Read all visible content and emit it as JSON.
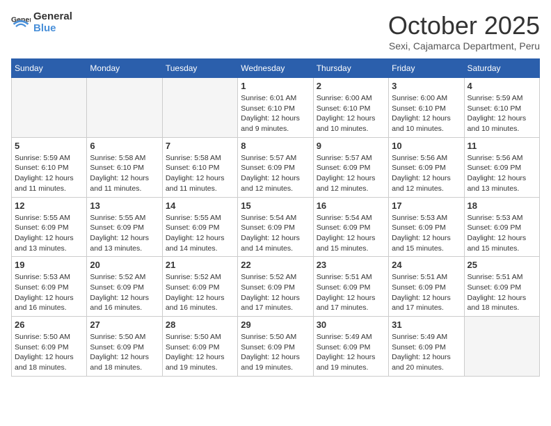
{
  "logo": {
    "text_general": "General",
    "text_blue": "Blue"
  },
  "header": {
    "month": "October 2025",
    "location": "Sexi, Cajamarca Department, Peru"
  },
  "weekdays": [
    "Sunday",
    "Monday",
    "Tuesday",
    "Wednesday",
    "Thursday",
    "Friday",
    "Saturday"
  ],
  "weeks": [
    [
      {
        "day": "",
        "info": ""
      },
      {
        "day": "",
        "info": ""
      },
      {
        "day": "",
        "info": ""
      },
      {
        "day": "1",
        "info": "Sunrise: 6:01 AM\nSunset: 6:10 PM\nDaylight: 12 hours and 9 minutes."
      },
      {
        "day": "2",
        "info": "Sunrise: 6:00 AM\nSunset: 6:10 PM\nDaylight: 12 hours and 10 minutes."
      },
      {
        "day": "3",
        "info": "Sunrise: 6:00 AM\nSunset: 6:10 PM\nDaylight: 12 hours and 10 minutes."
      },
      {
        "day": "4",
        "info": "Sunrise: 5:59 AM\nSunset: 6:10 PM\nDaylight: 12 hours and 10 minutes."
      }
    ],
    [
      {
        "day": "5",
        "info": "Sunrise: 5:59 AM\nSunset: 6:10 PM\nDaylight: 12 hours and 11 minutes."
      },
      {
        "day": "6",
        "info": "Sunrise: 5:58 AM\nSunset: 6:10 PM\nDaylight: 12 hours and 11 minutes."
      },
      {
        "day": "7",
        "info": "Sunrise: 5:58 AM\nSunset: 6:10 PM\nDaylight: 12 hours and 11 minutes."
      },
      {
        "day": "8",
        "info": "Sunrise: 5:57 AM\nSunset: 6:09 PM\nDaylight: 12 hours and 12 minutes."
      },
      {
        "day": "9",
        "info": "Sunrise: 5:57 AM\nSunset: 6:09 PM\nDaylight: 12 hours and 12 minutes."
      },
      {
        "day": "10",
        "info": "Sunrise: 5:56 AM\nSunset: 6:09 PM\nDaylight: 12 hours and 12 minutes."
      },
      {
        "day": "11",
        "info": "Sunrise: 5:56 AM\nSunset: 6:09 PM\nDaylight: 12 hours and 13 minutes."
      }
    ],
    [
      {
        "day": "12",
        "info": "Sunrise: 5:55 AM\nSunset: 6:09 PM\nDaylight: 12 hours and 13 minutes."
      },
      {
        "day": "13",
        "info": "Sunrise: 5:55 AM\nSunset: 6:09 PM\nDaylight: 12 hours and 13 minutes."
      },
      {
        "day": "14",
        "info": "Sunrise: 5:55 AM\nSunset: 6:09 PM\nDaylight: 12 hours and 14 minutes."
      },
      {
        "day": "15",
        "info": "Sunrise: 5:54 AM\nSunset: 6:09 PM\nDaylight: 12 hours and 14 minutes."
      },
      {
        "day": "16",
        "info": "Sunrise: 5:54 AM\nSunset: 6:09 PM\nDaylight: 12 hours and 15 minutes."
      },
      {
        "day": "17",
        "info": "Sunrise: 5:53 AM\nSunset: 6:09 PM\nDaylight: 12 hours and 15 minutes."
      },
      {
        "day": "18",
        "info": "Sunrise: 5:53 AM\nSunset: 6:09 PM\nDaylight: 12 hours and 15 minutes."
      }
    ],
    [
      {
        "day": "19",
        "info": "Sunrise: 5:53 AM\nSunset: 6:09 PM\nDaylight: 12 hours and 16 minutes."
      },
      {
        "day": "20",
        "info": "Sunrise: 5:52 AM\nSunset: 6:09 PM\nDaylight: 12 hours and 16 minutes."
      },
      {
        "day": "21",
        "info": "Sunrise: 5:52 AM\nSunset: 6:09 PM\nDaylight: 12 hours and 16 minutes."
      },
      {
        "day": "22",
        "info": "Sunrise: 5:52 AM\nSunset: 6:09 PM\nDaylight: 12 hours and 17 minutes."
      },
      {
        "day": "23",
        "info": "Sunrise: 5:51 AM\nSunset: 6:09 PM\nDaylight: 12 hours and 17 minutes."
      },
      {
        "day": "24",
        "info": "Sunrise: 5:51 AM\nSunset: 6:09 PM\nDaylight: 12 hours and 17 minutes."
      },
      {
        "day": "25",
        "info": "Sunrise: 5:51 AM\nSunset: 6:09 PM\nDaylight: 12 hours and 18 minutes."
      }
    ],
    [
      {
        "day": "26",
        "info": "Sunrise: 5:50 AM\nSunset: 6:09 PM\nDaylight: 12 hours and 18 minutes."
      },
      {
        "day": "27",
        "info": "Sunrise: 5:50 AM\nSunset: 6:09 PM\nDaylight: 12 hours and 18 minutes."
      },
      {
        "day": "28",
        "info": "Sunrise: 5:50 AM\nSunset: 6:09 PM\nDaylight: 12 hours and 19 minutes."
      },
      {
        "day": "29",
        "info": "Sunrise: 5:50 AM\nSunset: 6:09 PM\nDaylight: 12 hours and 19 minutes."
      },
      {
        "day": "30",
        "info": "Sunrise: 5:49 AM\nSunset: 6:09 PM\nDaylight: 12 hours and 19 minutes."
      },
      {
        "day": "31",
        "info": "Sunrise: 5:49 AM\nSunset: 6:09 PM\nDaylight: 12 hours and 20 minutes."
      },
      {
        "day": "",
        "info": ""
      }
    ]
  ]
}
